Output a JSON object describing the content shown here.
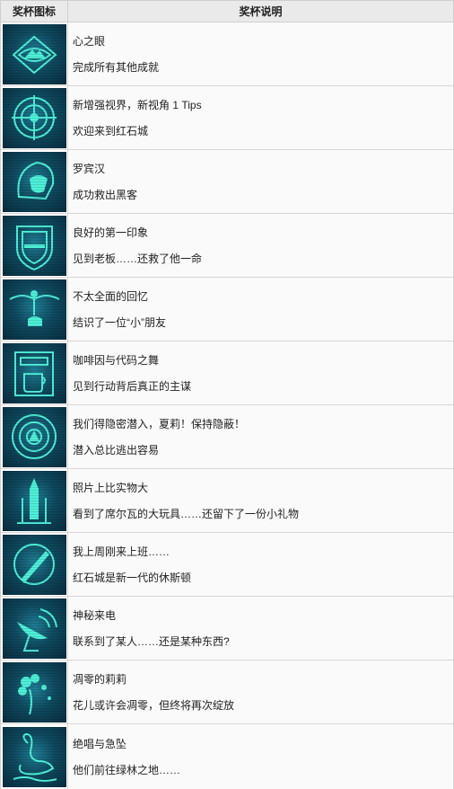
{
  "header": {
    "icon_col": "奖杯图标",
    "desc_col": "奖杯说明"
  },
  "trophies": [
    {
      "icon": "eye-mountain-icon",
      "title": "心之眼",
      "desc": "完成所有其他成就"
    },
    {
      "icon": "compass-emblem-icon",
      "title": "新增强视界，新视角 1 Tips",
      "desc": "欢迎来到红石城"
    },
    {
      "icon": "hooded-head-icon",
      "title": "罗宾汉",
      "desc": "成功救出黑客"
    },
    {
      "icon": "shield-badge-icon",
      "title": "良好的第一印象",
      "desc": "见到老板……还救了他一命"
    },
    {
      "icon": "winged-figure-icon",
      "title": "不太全面的回忆",
      "desc": "结识了一位“小”朋友"
    },
    {
      "icon": "coffee-machine-icon",
      "title": "咖啡因与代码之舞",
      "desc": "见到行动背后真正的主谋"
    },
    {
      "icon": "radar-target-icon",
      "title": "我们得隐密潜入，夏莉！保持隐蔽！",
      "desc": "潜入总比逃出容易"
    },
    {
      "icon": "rocket-icon",
      "title": "照片上比实物大",
      "desc": "看到了席尔瓦的大玩具……还留下了一份小礼物"
    },
    {
      "icon": "slash-circle-icon",
      "title": "我上周刚来上班……",
      "desc": "红石城是新一代的休斯顿"
    },
    {
      "icon": "satellite-dish-icon",
      "title": "神秘来电",
      "desc": "联系到了某人……还是某种东西?"
    },
    {
      "icon": "withered-flower-icon",
      "title": "凋零的莉莉",
      "desc": "花儿或许会凋零，但终将再次绽放"
    },
    {
      "icon": "swan-icon",
      "title": "绝唱与急坠",
      "desc": "他们前往绿林之地……"
    }
  ],
  "colors": {
    "glyph": "#4ef0d8",
    "icon_bg": "#0f4a60",
    "header_bg": "#eaeaea"
  }
}
